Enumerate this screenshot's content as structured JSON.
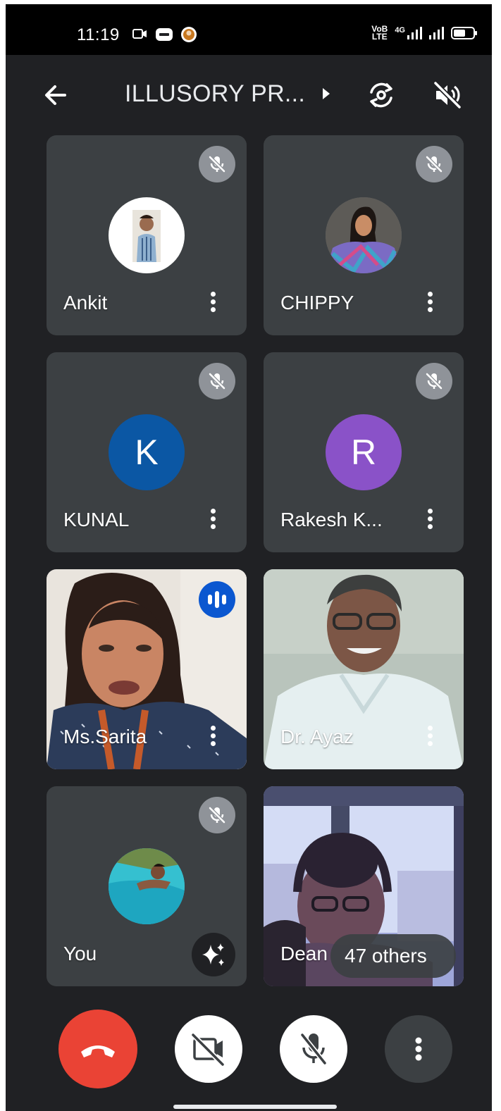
{
  "status_bar": {
    "time": "11:19",
    "notification_icons": [
      "video-camera-icon",
      "app-badge-icon",
      "app-avatar-icon"
    ],
    "network_label_top": "VoB",
    "network_label_bottom": "LTE",
    "data_label": "4G",
    "icons": [
      "signal-icon",
      "signal-icon",
      "battery-icon"
    ]
  },
  "header": {
    "title": "ILLUSORY PR...",
    "back_icon": "arrow-back-icon",
    "switch_camera_icon": "switch-camera-icon",
    "speaker_icon": "speaker-off-icon"
  },
  "participants": [
    {
      "name": "Ankit",
      "mic": "muted",
      "avatar": "photo"
    },
    {
      "name": "CHIPPY",
      "mic": "muted",
      "avatar": "photo"
    },
    {
      "name": "KUNAL",
      "mic": "muted",
      "avatar_letter": "K",
      "avatar_color": "#0b57a4"
    },
    {
      "name": "Rakesh K...",
      "mic": "muted",
      "avatar_letter": "R",
      "avatar_color": "#8a52c8"
    },
    {
      "name": "Ms.Sarita",
      "mic": "speaking",
      "avatar": "video"
    },
    {
      "name": "Dr. Ayaz",
      "mic": "on",
      "avatar": "video"
    },
    {
      "name": "You",
      "mic": "muted",
      "avatar": "photo"
    },
    {
      "name": "Dean",
      "mic": "on",
      "avatar": "video"
    }
  ],
  "others_chip": {
    "label": "47 others"
  },
  "controls": {
    "end_call_icon": "end-call-icon",
    "camera_icon": "camera-off-icon",
    "mic_icon": "mic-off-icon",
    "more_icon": "more-vert-icon"
  },
  "colors": {
    "background": "#202124",
    "tile": "#3c4043",
    "end_call": "#ea4335",
    "speaking_badge": "#0b57d0"
  }
}
